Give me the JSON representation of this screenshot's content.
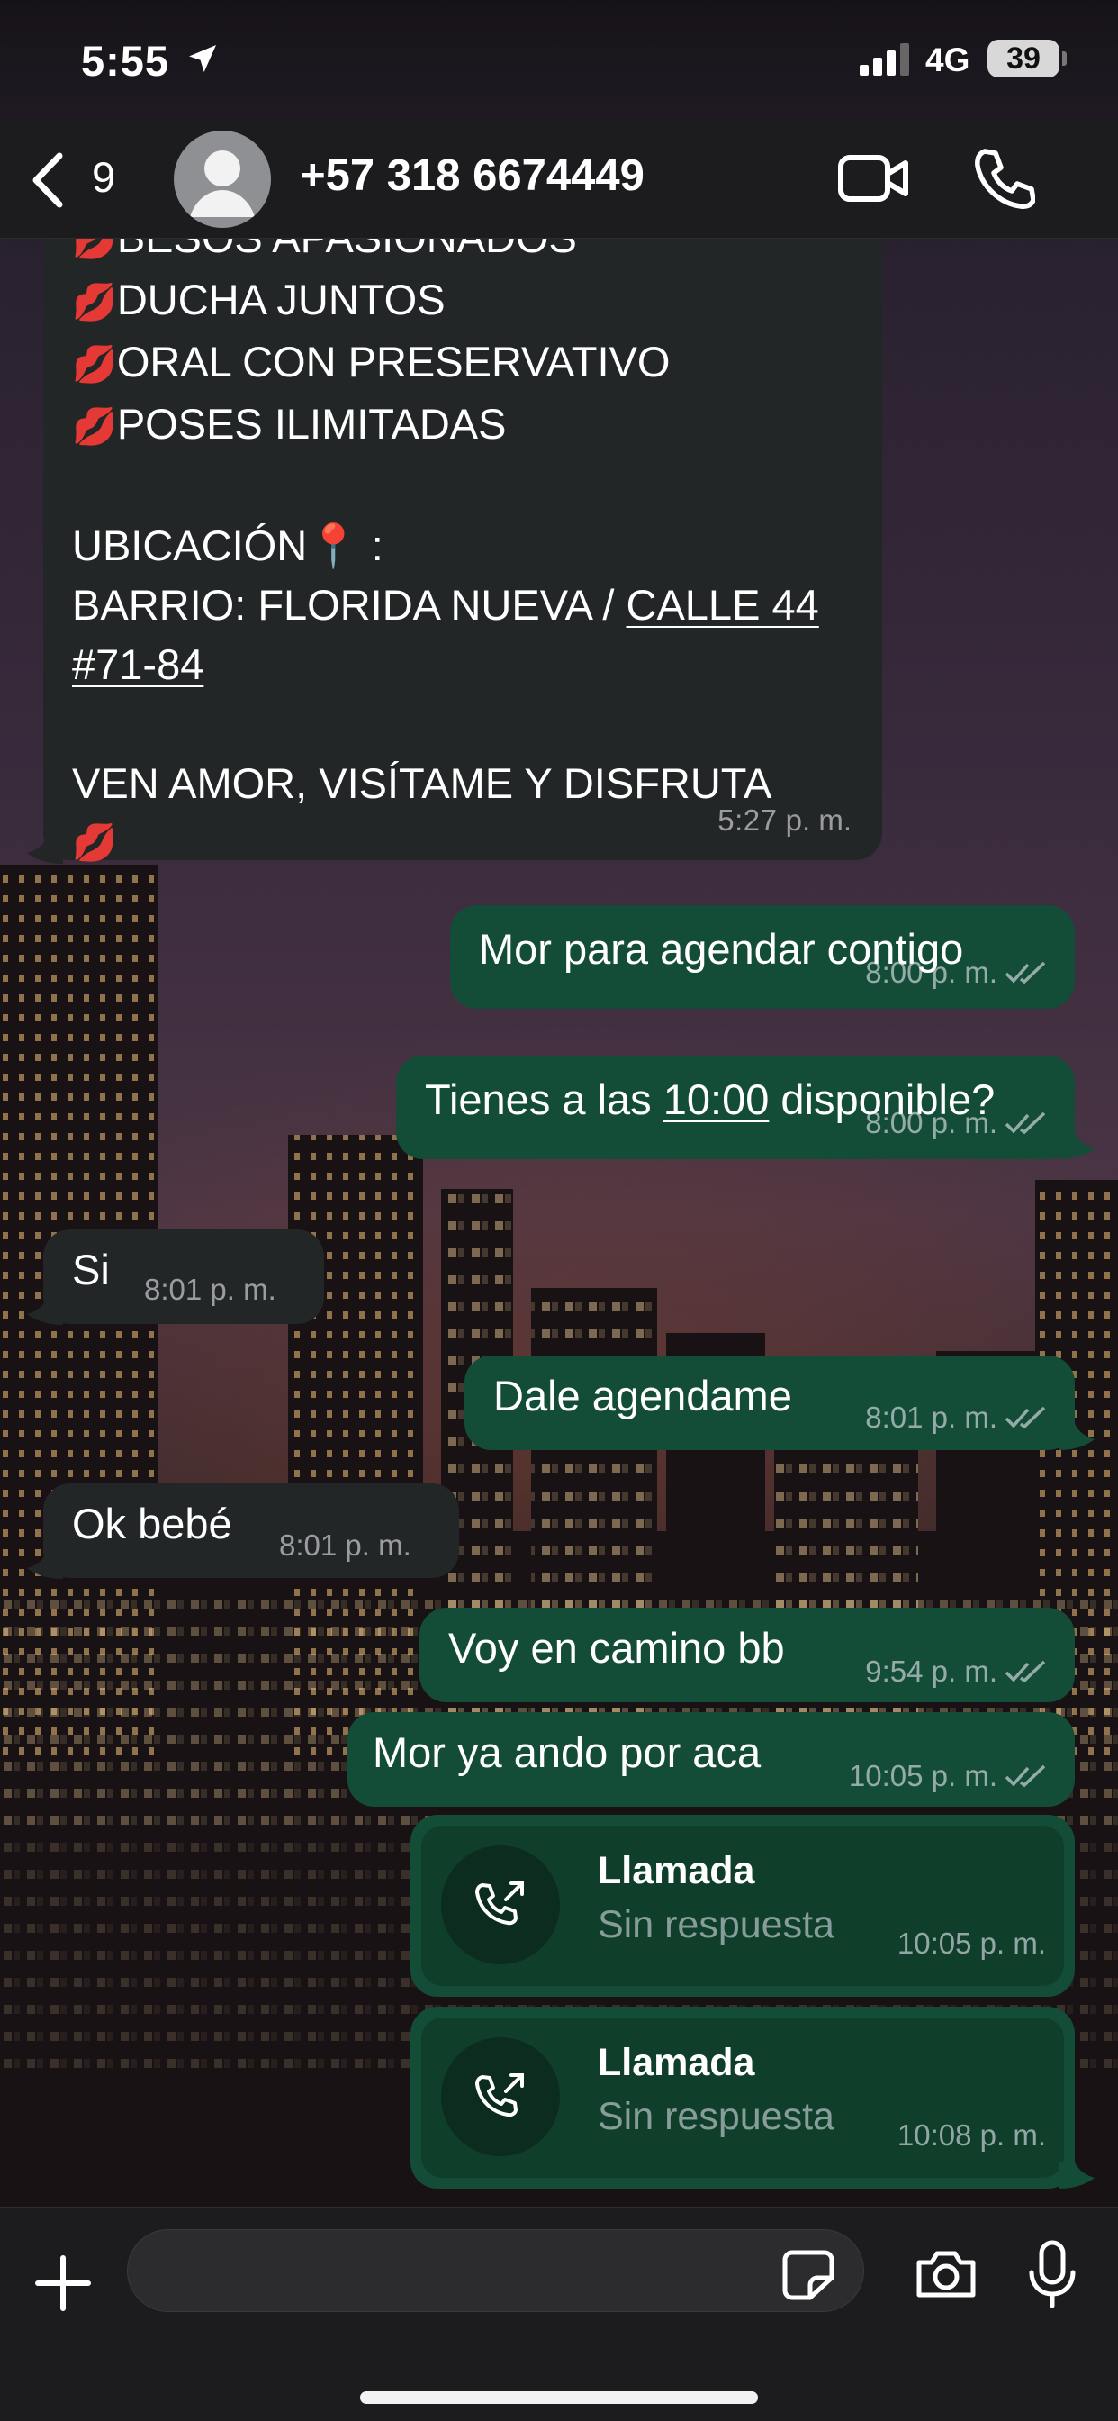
{
  "status_bar": {
    "time": "5:55",
    "network": "4G",
    "battery": "39"
  },
  "header": {
    "back_count": "9",
    "contact": "+57 318 6674449"
  },
  "messages": {
    "m1": {
      "lines": [
        "BESOS APASIONADOS",
        "DUCHA JUNTOS",
        "ORAL CON PRESERVATIVO",
        "POSES ILIMITADAS"
      ],
      "loc_label": "UBICACIÓN",
      "loc_suffix": " :",
      "barrio": "BARRIO: FLORIDA NUEVA / ",
      "addr1": "CALLE 44",
      "addr2": "#71-84",
      "closing": "VEN AMOR, VISÍTAME Y DISFRUTA",
      "time": "5:27",
      "ampm": "p. m."
    },
    "m2": {
      "text": "Mor para agendar contigo",
      "time": "8:00",
      "ampm": "p. m."
    },
    "m3": {
      "text_a": "Tienes a las ",
      "text_link": "10:00",
      "text_b": " disponible?",
      "time": "8:00",
      "ampm": "p. m."
    },
    "m4": {
      "text": "Si",
      "time": "8:01",
      "ampm": "p. m."
    },
    "m5": {
      "text": "Dale agendame",
      "time": "8:01",
      "ampm": "p. m."
    },
    "m6": {
      "text": "Ok bebé",
      "time": "8:01",
      "ampm": "p. m."
    },
    "m7": {
      "text": "Voy en camino bb",
      "time": "9:54",
      "ampm": "p. m."
    },
    "m8": {
      "text": "Mor ya ando por aca",
      "time": "10:05",
      "ampm": "p. m."
    },
    "call1": {
      "title": "Llamada",
      "status": "Sin respuesta",
      "time": "10:05",
      "ampm": "p. m."
    },
    "call2": {
      "title": "Llamada",
      "status": "Sin respuesta",
      "time": "10:08",
      "ampm": "p. m."
    }
  },
  "composer": {
    "value": ""
  },
  "colors": {
    "incoming": "#232626",
    "outgoing": "#144d37",
    "call_inner": "#0f3e2b",
    "header": "#1c1c1e"
  },
  "icons": [
    "location-arrow-icon",
    "signal-icon",
    "back-chevron-icon",
    "avatar-icon",
    "video-call-icon",
    "phone-call-icon",
    "kiss-icon",
    "pin-icon",
    "double-check-icon",
    "outgoing-call-icon",
    "plus-icon",
    "sticker-icon",
    "camera-icon",
    "microphone-icon"
  ]
}
